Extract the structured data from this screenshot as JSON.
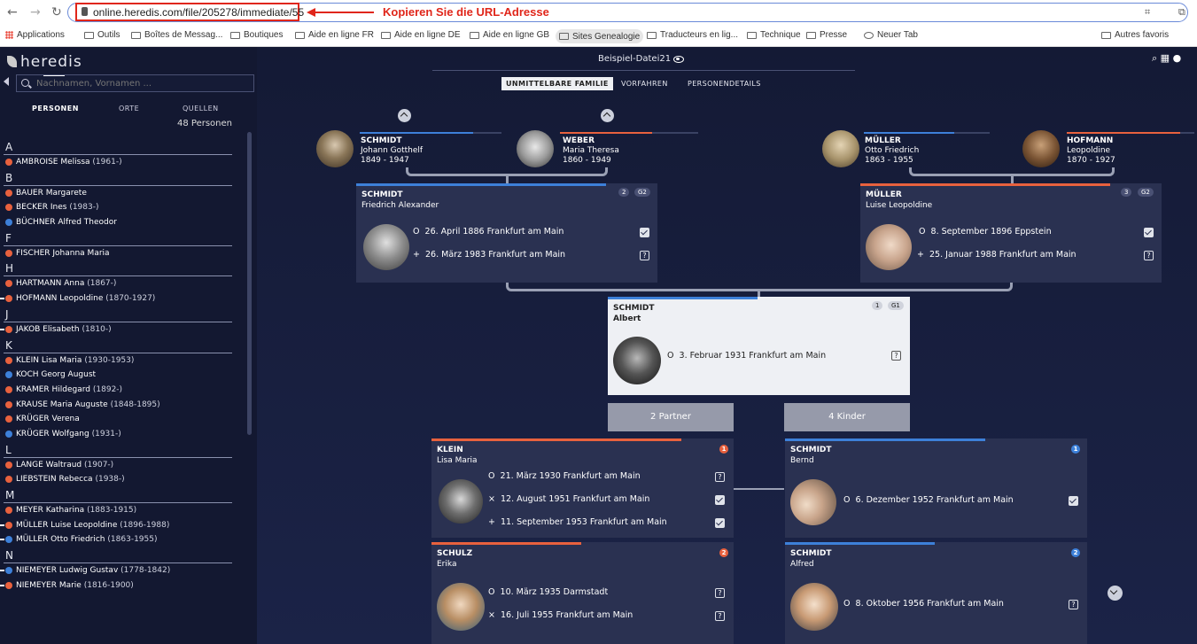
{
  "browser": {
    "url": "online.heredis.com/file/205278/immediate/55",
    "annotation": "Kopieren Sie die URL-Adresse",
    "bookmarks": [
      "Applications",
      "Outils",
      "Boîtes de Messag...",
      "Boutiques",
      "Aide en ligne FR",
      "Aide en ligne DE",
      "Aide en ligne GB",
      "Sites Genealogie",
      "Traducteurs en lig...",
      "Technique",
      "Presse",
      "Neuer Tab",
      "Autres favoris"
    ]
  },
  "app": {
    "logo": "heredis",
    "search_placeholder": "Nachnamen, Vornamen ...",
    "tabs": [
      "PERSONEN",
      "ORTE",
      "QUELLEN"
    ],
    "count": "48 Personen",
    "file_name": "Beispiel-Datei21",
    "main_tabs": [
      "UNMITTELBARE FAMILIE",
      "VORFAHREN",
      "PERSONENDETAILS"
    ]
  },
  "persons": [
    {
      "letter": "A"
    },
    {
      "name": "AMBROISE Melissa",
      "years": "(1961-)",
      "g": "f",
      "d": false
    },
    {
      "letter": "B"
    },
    {
      "name": "BAUER Margarete",
      "years": "",
      "g": "f",
      "d": false
    },
    {
      "name": "BECKER Ines",
      "years": "(1983-)",
      "g": "f",
      "d": false
    },
    {
      "name": "BÜCHNER Alfred Theodor",
      "years": "",
      "g": "m",
      "d": false
    },
    {
      "letter": "F"
    },
    {
      "name": "FISCHER Johanna Maria",
      "years": "",
      "g": "f",
      "d": false
    },
    {
      "letter": "H"
    },
    {
      "name": "HARTMANN Anna",
      "years": "(1867-)",
      "g": "f",
      "d": false
    },
    {
      "name": "HOFMANN Leopoldine",
      "years": "(1870-1927)",
      "g": "f",
      "d": true
    },
    {
      "letter": "J"
    },
    {
      "name": "JAKOB Elisabeth",
      "years": "(1810-)",
      "g": "f",
      "d": true
    },
    {
      "letter": "K"
    },
    {
      "name": "KLEIN Lisa Maria",
      "years": "(1930-1953)",
      "g": "f",
      "d": false
    },
    {
      "name": "KOCH Georg August",
      "years": "",
      "g": "m",
      "d": false
    },
    {
      "name": "KRAMER Hildegard",
      "years": "(1892-)",
      "g": "f",
      "d": false
    },
    {
      "name": "KRAUSE Maria Auguste",
      "years": "(1848-1895)",
      "g": "f",
      "d": false
    },
    {
      "name": "KRÜGER Verena",
      "years": "",
      "g": "f",
      "d": false
    },
    {
      "name": "KRÜGER Wolfgang",
      "years": "(1931-)",
      "g": "m",
      "d": false
    },
    {
      "letter": "L"
    },
    {
      "name": "LANGE Waltraud",
      "years": "(1907-)",
      "g": "f",
      "d": false
    },
    {
      "name": "LIEBSTEIN Rebecca",
      "years": "(1938-)",
      "g": "f",
      "d": false
    },
    {
      "letter": "M"
    },
    {
      "name": "MEYER Katharina",
      "years": "(1883-1915)",
      "g": "f",
      "d": false
    },
    {
      "name": "MÜLLER Luise Leopoldine",
      "years": "(1896-1988)",
      "g": "f",
      "d": true
    },
    {
      "name": "MÜLLER Otto Friedrich",
      "years": "(1863-1955)",
      "g": "m",
      "d": true
    },
    {
      "letter": "N"
    },
    {
      "name": "NIEMEYER Ludwig Gustav",
      "years": "(1778-1842)",
      "g": "m",
      "d": true
    },
    {
      "name": "NIEMEYER Marie",
      "years": "(1816-1900)",
      "g": "f",
      "d": true
    }
  ],
  "grandparents": [
    {
      "last": "SCHMIDT",
      "first": "Johann Gotthelf",
      "years": "1849 - 1947"
    },
    {
      "last": "WEBER",
      "first": "Maria Theresa",
      "years": "1860 - 1949"
    },
    {
      "last": "MÜLLER",
      "first": "Otto Friedrich",
      "years": "1863 - 1955"
    },
    {
      "last": "HOFMANN",
      "first": "Leopoldine",
      "years": "1870 - 1927"
    }
  ],
  "father": {
    "last": "SCHMIDT",
    "first": "Friedrich Alexander",
    "b1": "2",
    "b2": "G2",
    "birth": "26. April 1886 Frankfurt am Main",
    "death": "26. März 1983 Frankfurt am Main"
  },
  "mother": {
    "last": "MÜLLER",
    "first": "Luise Leopoldine",
    "b1": "3",
    "b2": "G2",
    "birth": "8. September 1896 Eppstein",
    "death": "25. Januar 1988 Frankfurt am Main"
  },
  "subject": {
    "last": "SCHMIDT",
    "first": "Albert",
    "b1": "1",
    "b2": "G1",
    "birth": "3. Februar 1931 Frankfurt am Main"
  },
  "partners_btn": "2 Partner",
  "children_btn": "4 Kinder",
  "partners": [
    {
      "last": "KLEIN",
      "first": "Lisa Maria",
      "num": "1",
      "birth": "21. März 1930 Frankfurt am Main",
      "marriage": "12. August 1951 Frankfurt am Main",
      "death": "11. September 1953 Frankfurt am Main"
    },
    {
      "last": "SCHULZ",
      "first": "Erika",
      "num": "2",
      "birth": "10. März 1935 Darmstadt",
      "marriage": "16. Juli 1955 Frankfurt am Main"
    }
  ],
  "children": [
    {
      "last": "SCHMIDT",
      "first": "Bernd",
      "num": "1",
      "birth": "6. Dezember 1952 Frankfurt am Main"
    },
    {
      "last": "SCHMIDT",
      "first": "Alfred",
      "num": "2",
      "birth": "8. Oktober 1956 Frankfurt am Main"
    }
  ],
  "symbols": {
    "birth": "O",
    "death": "+",
    "marriage": "×",
    "unknown": "?"
  },
  "colors": {
    "female": "#e8613e",
    "male": "#3d80d9",
    "annotation": "#e0261a"
  }
}
